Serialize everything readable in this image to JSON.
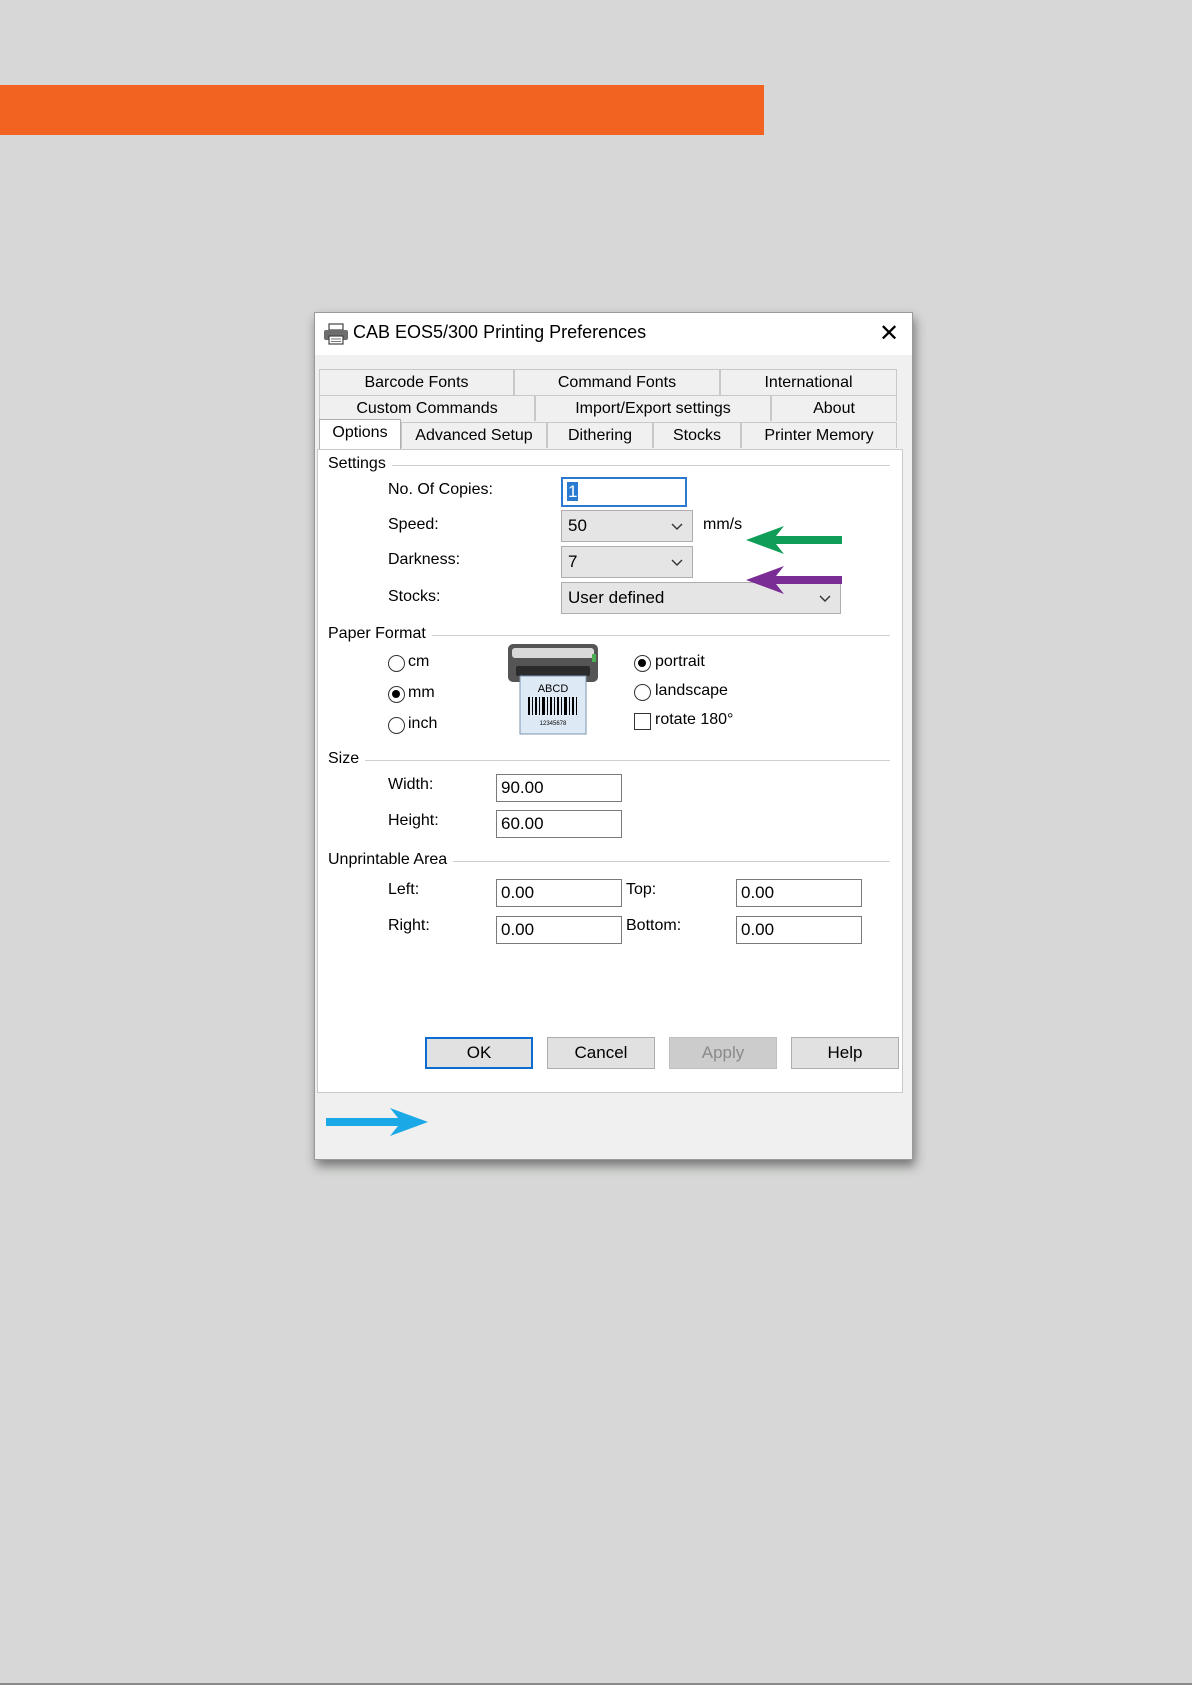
{
  "colors": {
    "page_background": "#d6d7d6",
    "orange_bar": "#f26322",
    "arrow_speed": "#0f9d58",
    "arrow_darkness": "#7b2d96",
    "arrow_ok": "#1aa9e6",
    "focus_border": "#2a7ad2"
  },
  "dialog": {
    "title": "CAB EOS5/300 Printing Preferences",
    "title_icon": "printer-icon",
    "close_glyph": "✕"
  },
  "tabs": {
    "row1": [
      "Barcode Fonts",
      "Command Fonts",
      "International"
    ],
    "row2": [
      "Custom Commands",
      "Import/Export settings",
      "About"
    ],
    "row3": [
      "Options",
      "Advanced Setup",
      "Dithering",
      "Stocks",
      "Printer Memory"
    ],
    "active": "Options"
  },
  "settings": {
    "group_label": "Settings",
    "copies_label": "No. Of Copies:",
    "copies_value": "1",
    "speed_label": "Speed:",
    "speed_value": "50",
    "speed_unit": "mm/s",
    "darkness_label": "Darkness:",
    "darkness_value": "7",
    "stocks_label": "Stocks:",
    "stocks_value": "User defined"
  },
  "paper_format": {
    "group_label": "Paper Format",
    "units": [
      "cm",
      "mm",
      "inch"
    ],
    "selected_unit": "mm",
    "orientations": [
      "portrait",
      "landscape"
    ],
    "selected_orientation": "portrait",
    "rotate_label": "rotate 180°",
    "rotate_checked": false,
    "preview_label": "ABCD",
    "preview_number": "12345678"
  },
  "size": {
    "group_label": "Size",
    "width_label": "Width:",
    "width_value": "90.00",
    "height_label": "Height:",
    "height_value": "60.00"
  },
  "unprintable": {
    "group_label": "Unprintable Area",
    "left_label": "Left:",
    "left_value": "0.00",
    "top_label": "Top:",
    "top_value": "0.00",
    "right_label": "Right:",
    "right_value": "0.00",
    "bottom_label": "Bottom:",
    "bottom_value": "0.00"
  },
  "buttons": {
    "ok": "OK",
    "cancel": "Cancel",
    "apply": "Apply",
    "help": "Help"
  }
}
